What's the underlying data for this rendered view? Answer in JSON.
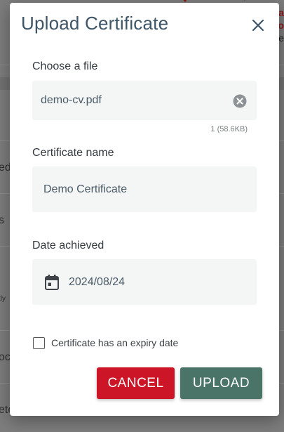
{
  "background": {
    "fragments": [
      "ed",
      "s",
      "tly",
      "oc",
      "ete"
    ],
    "right_fragments": [
      "La",
      "o",
      "Pe"
    ]
  },
  "dialog": {
    "title": "Upload Certificate",
    "close_icon": "close-icon",
    "file_field": {
      "label": "Choose a file",
      "value": "demo-cv.pdf",
      "meta": "1 (58.6KB)",
      "clear_icon": "clear-circle-icon"
    },
    "name_field": {
      "label": "Certificate name",
      "value": "Demo Certificate"
    },
    "date_field": {
      "label": "Date achieved",
      "value": "2024/08/24",
      "icon": "calendar-icon"
    },
    "expiry_checkbox": {
      "label": "Certificate has an expiry date",
      "checked": false
    },
    "buttons": {
      "cancel": "CANCEL",
      "upload": "UPLOAD"
    }
  },
  "colors": {
    "title": "#3d5566",
    "cancel": "#cc1526",
    "upload": "#4a7468",
    "field_bg": "#f4f5f5"
  }
}
